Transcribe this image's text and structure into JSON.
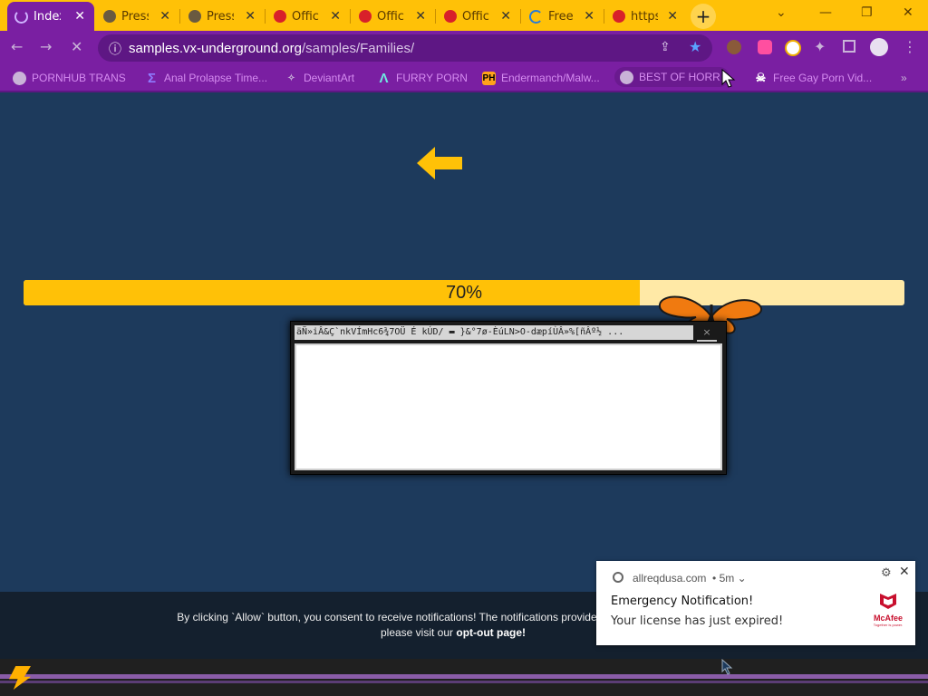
{
  "browser": {
    "tabs": [
      {
        "title": "Index",
        "active": true,
        "favicon": "loading-spinner-icon"
      },
      {
        "title": "Press",
        "active": false,
        "favicon": "globe-icon"
      },
      {
        "title": "Press",
        "active": false,
        "favicon": "globe-icon"
      },
      {
        "title": "Offic",
        "active": false,
        "favicon": "mcafee-shield-icon"
      },
      {
        "title": "Offic",
        "active": false,
        "favicon": "mcafee-shield-icon"
      },
      {
        "title": "Offic",
        "active": false,
        "favicon": "mcafee-shield-icon"
      },
      {
        "title": "Free",
        "active": false,
        "favicon": "loading-spinner-icon"
      },
      {
        "title": "https",
        "active": false,
        "favicon": "mcafee-shield-icon"
      }
    ],
    "address": {
      "host": "samples.vx-underground.org",
      "path": "/samples/Families/"
    },
    "bookmarks": [
      {
        "label": "PORNHUB TRANS",
        "icon": "globe-icon"
      },
      {
        "label": "Anal Prolapse Time...",
        "icon": "sigma-icon"
      },
      {
        "label": "DeviantArt",
        "icon": "deviantart-icon"
      },
      {
        "label": "FURRY PORN",
        "icon": "lambda-icon"
      },
      {
        "label": "Endermanch/Malw...",
        "icon": "ph-icon"
      },
      {
        "label": "BEST OF HORR",
        "icon": "globe-icon"
      },
      {
        "label": "Free Gay Porn Vid...",
        "icon": "skull-icon"
      }
    ]
  },
  "page": {
    "progress_label": "70%",
    "progress_fraction": 0.7,
    "accent_color": "#ffc107",
    "background_color": "#1d3a5c"
  },
  "popup": {
    "title": "äÑ»iÂ&Ç`nkVÍmHc6¾7OÜ É kÚD/ ▬ }&°7ø-ÈúLN>O-dæpíÙÂ»%[ñÂº½ ...",
    "close": "×"
  },
  "consent": {
    "text_start": "By clicking `Allow` button, you consent to receive notifications! The notifications provide news and advertising mate",
    "text_line2_start": "please visit our ",
    "optout_label": "opt-out page",
    "text_line2_end": "!"
  },
  "notification": {
    "origin": "allreqdusa.com",
    "time": "• 5m",
    "title": "Emergency Notification!",
    "body": "Your  license has just expired!",
    "brand": "McAfee",
    "brand_tagline": "Together is power."
  }
}
